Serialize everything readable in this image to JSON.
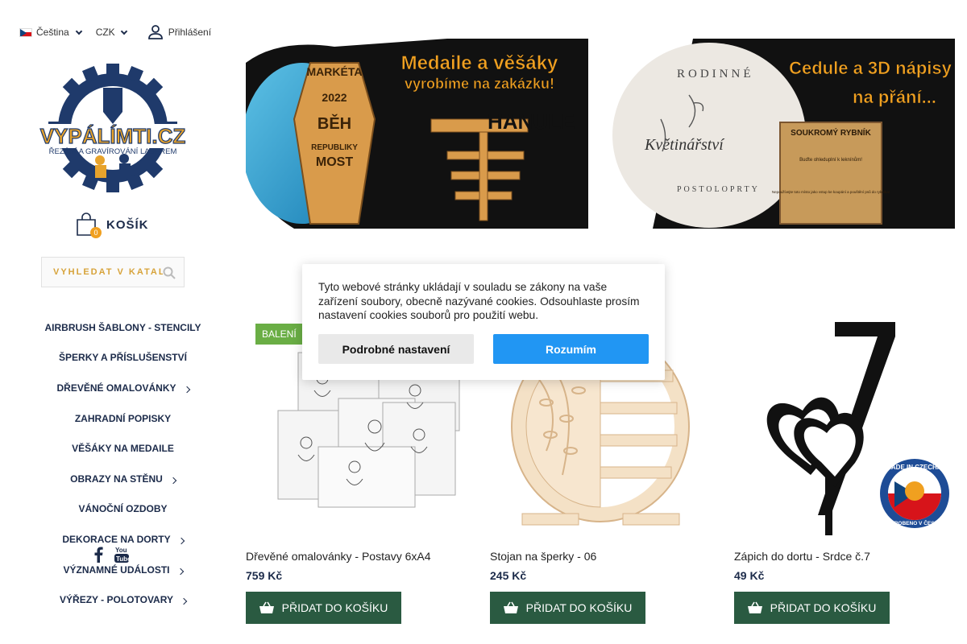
{
  "topbar": {
    "language": "Čeština",
    "currency": "CZK",
    "login": "Přihlášení"
  },
  "logo": {
    "name": "VYPÁLÍMTI.CZ",
    "tagline": "ŘEZÁNÍ A GRAVÍROVÁNÍ LASEREM"
  },
  "cart": {
    "label": "KOŠÍK",
    "count": "0"
  },
  "search": {
    "placeholder": "VYHLEDAT V KATALOGU"
  },
  "nav": {
    "items": [
      {
        "label": "AIRBRUSH ŠABLONY - STENCILY",
        "submenu": false
      },
      {
        "label": "ŠPERKY A PŘÍSLUŠENSTVÍ",
        "submenu": false
      },
      {
        "label": "DŘEVĚNÉ OMALOVÁNKY",
        "submenu": true
      },
      {
        "label": "ZAHRADNÍ POPISKY",
        "submenu": false
      },
      {
        "label": "VĚŠÁKY NA MEDAILE",
        "submenu": false
      },
      {
        "label": "OBRAZY NA STĚNU",
        "submenu": true
      },
      {
        "label": "VÁNOČNÍ OZDOBY",
        "submenu": false
      },
      {
        "label": "DEKORACE NA DORTY",
        "submenu": true
      },
      {
        "label": "VÝZNAMNÉ UDÁLOSTI",
        "submenu": true
      },
      {
        "label": "VÝŘEZY - POLOTOVARY",
        "submenu": true
      }
    ]
  },
  "social": [
    "facebook-icon",
    "youtube-icon"
  ],
  "banners": [
    {
      "headline_line1": "Medaile a věšáky",
      "headline_line2": "vyrobíme na zakázku!",
      "medal_text": [
        "MARKÉTA",
        "2022",
        "BĚH",
        "REPUBLIKY",
        "MOST"
      ],
      "hanger_text": "HANULE"
    },
    {
      "headline_line1": "Cedule a 3D nápisy",
      "headline_line2": "na přání...",
      "sign_text_top": "RODINNÉ",
      "sign_text_mid": "Květinářství",
      "sign_text_bottom": "POSTOLOPRTY",
      "board_title": "SOUKROMÝ RYBNÍK",
      "board_text1": "Buďte ohleduplní k leknínům!",
      "board_text2": "Nepoužívejte toto místo jako vstup ke koupání a pouštění psů do rybníka!"
    }
  ],
  "products": [
    {
      "name": "Dřevěné omalovánky - Postavy 6xA4",
      "price": "759 Kč",
      "badge": "BALENÍ",
      "button": "PŘIDAT DO KOŠÍKU"
    },
    {
      "name": "Stojan na šperky - 06",
      "price": "245 Kč",
      "badge": "",
      "button": "PŘIDAT DO KOŠÍKU"
    },
    {
      "name": "Zápich do dortu - Srdce č.7",
      "price": "49 Kč",
      "badge": "",
      "button": "PŘIDAT DO KOŠÍKU"
    }
  ],
  "cookie": {
    "text": "Tyto webové stránky ukládají v souladu se zákony na vaše zařízení soubory, obecně nazývané cookies. Odsouhlaste prosím nastavení cookies souborů pro použití webu.",
    "settings_button": "Podrobné nastavení",
    "accept_button": "Rozumím"
  },
  "made_in": {
    "top": "MADE IN CZECHIA",
    "bottom": "VYROBENO V ČESKU"
  },
  "colors": {
    "navy": "#1c2b4a",
    "gold": "#f0a020",
    "green": "#2a5a41",
    "blue": "#2196f3",
    "badge_green": "#6aae45"
  }
}
